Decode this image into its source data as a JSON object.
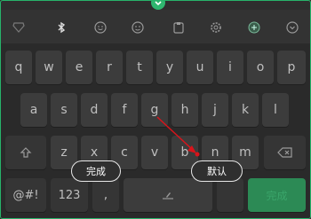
{
  "keyboard": {
    "row1": [
      "q",
      "w",
      "e",
      "r",
      "t",
      "y",
      "u",
      "i",
      "o",
      "p"
    ],
    "row2": [
      "a",
      "s",
      "d",
      "f",
      "g",
      "h",
      "j",
      "k",
      "l"
    ],
    "row3": [
      "z",
      "x",
      "c",
      "v",
      "b",
      "n",
      "m"
    ],
    "bottom": {
      "symbols": "@#!",
      "numbers": "123",
      "comma": ",",
      "enter": "完成"
    }
  },
  "pills": {
    "done": "完成",
    "default": "默认"
  },
  "colors": {
    "accent": "#27b36a",
    "arrow": "#d9141b"
  },
  "icons": {
    "toolbar": [
      "diamond-icon",
      "bluetooth-icon",
      "emoji-icon",
      "clipboard-icon",
      "settings-icon",
      "grid-icon",
      "collapse-icon"
    ],
    "drag": "chevron-down-icon"
  }
}
